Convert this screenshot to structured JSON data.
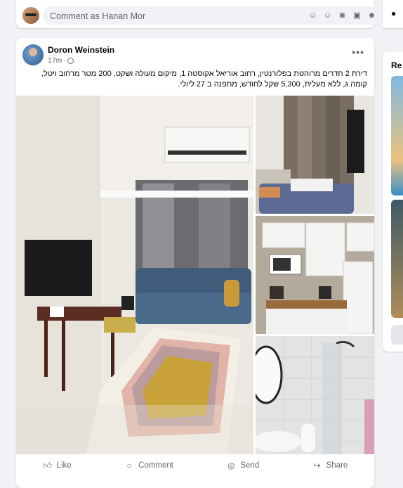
{
  "composer": {
    "placeholder": "Comment as Hanan Mor"
  },
  "post": {
    "author": "Doron Weinstein",
    "time": "17m",
    "text": "דירת 2 חדרים מרוהטת בפלורנטין, רחוב אוריאל אקוסטה 1, מיקום מעולה ושקט, 200 מטר מרחוב ויטל, קומה ג, ללא מעלית, 5,300 שקל לחודש, מתפנה ב 27 ליולי.",
    "more_label": "•••"
  },
  "actions": {
    "like": "Like",
    "comment": "Comment",
    "send": "Send",
    "share": "Share"
  },
  "sidebar": {
    "reels_title": "Re"
  },
  "icons": [
    "emoji-icon",
    "camera-icon",
    "gif-icon",
    "sticker-icon",
    "avatar-icon"
  ]
}
